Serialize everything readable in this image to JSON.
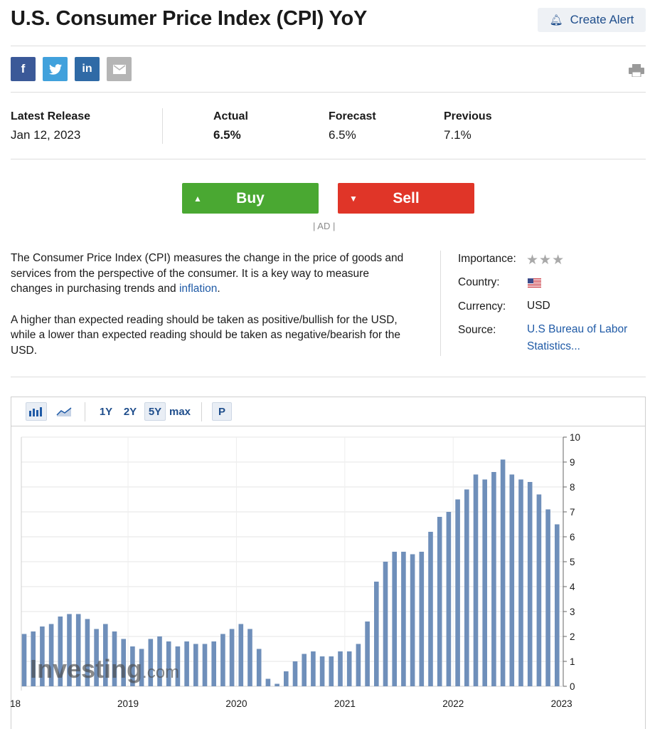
{
  "header": {
    "title": "U.S. Consumer Price Index (CPI) YoY",
    "create_alert_label": "Create Alert"
  },
  "share": {
    "facebook": "f",
    "twitter": "t",
    "linkedin": "in",
    "email": "email-icon"
  },
  "release": {
    "latest_label": "Latest Release",
    "latest_date": "Jan 12, 2023",
    "actual_label": "Actual",
    "actual_value": "6.5%",
    "forecast_label": "Forecast",
    "forecast_value": "6.5%",
    "previous_label": "Previous",
    "previous_value": "7.1%"
  },
  "trade": {
    "buy_label": "Buy",
    "sell_label": "Sell",
    "ad_label": "| AD |"
  },
  "description": {
    "p1_text": "The Consumer Price Index (CPI) measures the change in the price of goods and services from the perspective of the consumer. It is a key way to measure changes in purchasing trends and ",
    "p1_link": "inflation",
    "p1_end": ".",
    "p2": "A higher than expected reading should be taken as positive/bullish for the USD, while a lower than expected reading should be taken as negative/bearish for the USD."
  },
  "meta": {
    "importance_label": "Importance:",
    "importance_stars": 3,
    "country_label": "Country:",
    "currency_label": "Currency:",
    "currency_value": "USD",
    "source_label": "Source:",
    "source_value": "U.S Bureau of Labor Statistics..."
  },
  "toolbar": {
    "range_1y": "1Y",
    "range_2y": "2Y",
    "range_5y": "5Y",
    "range_max": "max",
    "p_label": "P",
    "selected_range": "5Y"
  },
  "colors": {
    "bar": "#6f8fba",
    "buy": "#4aa832",
    "sell": "#e03528",
    "link": "#1f5aa6"
  },
  "chart_data": {
    "type": "bar",
    "watermark": "Investing.com",
    "ylim": [
      0,
      10
    ],
    "yticks": [
      "0",
      "1",
      "2",
      "3",
      "4",
      "5",
      "6",
      "7",
      "8",
      "9",
      "10"
    ],
    "xtick_labels": [
      "18",
      "2019",
      "2020",
      "2021",
      "2022",
      "2023"
    ],
    "x_start": "2018-01",
    "x_end": "2022-12",
    "grid": true,
    "values": [
      2.1,
      2.2,
      2.4,
      2.5,
      2.8,
      2.9,
      2.9,
      2.7,
      2.3,
      2.5,
      2.2,
      1.9,
      1.6,
      1.5,
      1.9,
      2.0,
      1.8,
      1.6,
      1.8,
      1.7,
      1.7,
      1.8,
      2.1,
      2.3,
      2.5,
      2.3,
      1.5,
      0.3,
      0.1,
      0.6,
      1.0,
      1.3,
      1.4,
      1.2,
      1.2,
      1.4,
      1.4,
      1.7,
      2.6,
      4.2,
      5.0,
      5.4,
      5.4,
      5.3,
      5.4,
      6.2,
      6.8,
      7.0,
      7.5,
      7.9,
      8.5,
      8.3,
      8.6,
      9.1,
      8.5,
      8.3,
      8.2,
      7.7,
      7.1,
      6.5
    ]
  }
}
